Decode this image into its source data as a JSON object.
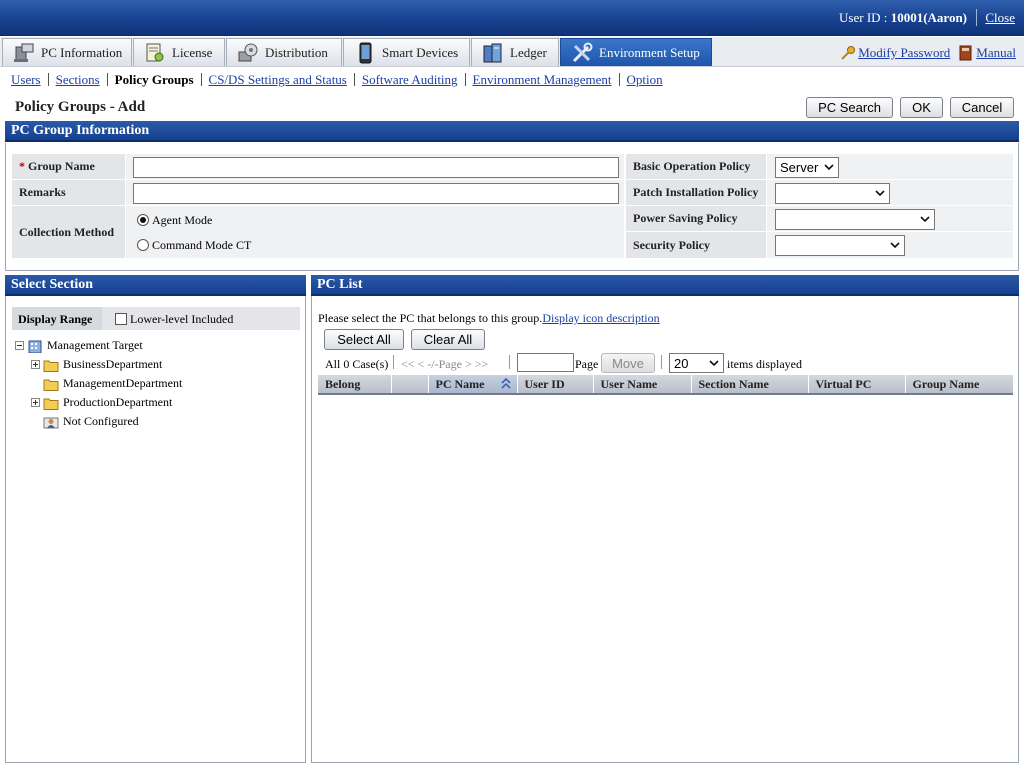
{
  "header": {
    "user_id_label": "User ID : ",
    "user_id_value": "10001(Aaron)",
    "close_link": "Close"
  },
  "tabs": [
    {
      "label": "PC Information",
      "icon": "pc-icon",
      "active": false
    },
    {
      "label": "License",
      "icon": "license-icon",
      "active": false
    },
    {
      "label": "Distribution",
      "icon": "distribution-icon",
      "active": false
    },
    {
      "label": "Smart Devices",
      "icon": "smartphone-icon",
      "active": false
    },
    {
      "label": "Ledger",
      "icon": "ledger-icon",
      "active": false
    },
    {
      "label": "Environment Setup",
      "icon": "tools-icon",
      "active": true
    }
  ],
  "top_links": {
    "modify_password": "Modify Password",
    "manual": "Manual"
  },
  "subnav": [
    {
      "label": "Users",
      "current": false
    },
    {
      "label": "Sections",
      "current": false
    },
    {
      "label": "Policy Groups",
      "current": true
    },
    {
      "label": "CS/DS Settings and Status",
      "current": false
    },
    {
      "label": "Software Auditing",
      "current": false
    },
    {
      "label": "Environment Management",
      "current": false
    },
    {
      "label": "Option",
      "current": false
    }
  ],
  "page": {
    "title": "Policy Groups - Add",
    "buttons": {
      "pc_search": "PC Search",
      "ok": "OK",
      "cancel": "Cancel"
    }
  },
  "group_info": {
    "section_title": "PC Group Information",
    "required_mark": "*",
    "group_name_label": "Group Name",
    "group_name_value": "",
    "remarks_label": "Remarks",
    "remarks_value": "",
    "collection_method_label": "Collection Method",
    "collection_options": [
      {
        "label": "Agent Mode",
        "selected": true
      },
      {
        "label": "Command Mode CT",
        "selected": false
      }
    ],
    "basic_operation_label": "Basic Operation Policy",
    "basic_operation_value": "Server",
    "patch_installation_label": "Patch Installation Policy",
    "patch_installation_value": "",
    "power_saving_label": "Power Saving Policy",
    "power_saving_value": "",
    "security_label": "Security Policy",
    "security_value": ""
  },
  "select_section": {
    "title": "Select Section",
    "display_range_label": "Display Range",
    "lower_level_label": "Lower-level Included",
    "lower_level_checked": false,
    "tree": {
      "root": "Management Target",
      "children": [
        {
          "label": "BusinessDepartment",
          "expandable": true
        },
        {
          "label": "ManagementDepartment",
          "expandable": false
        },
        {
          "label": "ProductionDepartment",
          "expandable": true
        },
        {
          "label": "Not Configured",
          "expandable": false
        }
      ]
    }
  },
  "pc_list": {
    "title": "PC List",
    "instruction": "Please select the PC that belongs to this group.",
    "icon_link": "Display icon description",
    "select_all": "Select All",
    "clear_all": "Clear All",
    "case_count": "All 0 Case(s)",
    "pager_nav": "<< < -/-Page > >>",
    "page_input": "",
    "page_label": "Page",
    "move_button": "Move",
    "per_page_value": "20",
    "items_label": "items displayed",
    "columns": [
      "Belong",
      "",
      "PC Name",
      "User ID",
      "User Name",
      "Section Name",
      "Virtual PC",
      "Group Name"
    ],
    "sorted_column": "PC Name",
    "rows": []
  },
  "colors": {
    "header_blue": "#163f8d",
    "active_tab": "#2a64b8",
    "link": "#1a3fa6"
  }
}
